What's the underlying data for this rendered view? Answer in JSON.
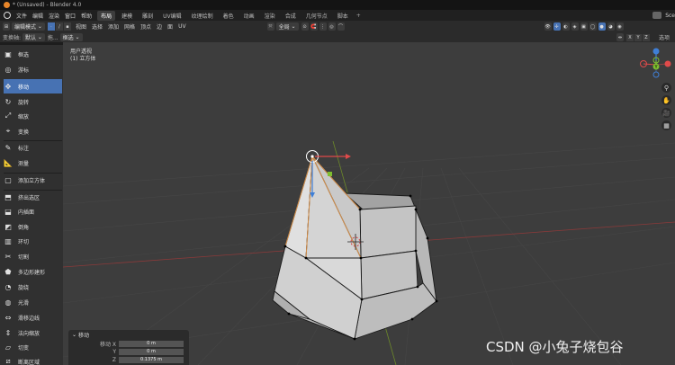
{
  "window": {
    "title": "* (Unsaved) - Blender 4.0"
  },
  "menubar": {
    "menus": [
      "文件",
      "编辑",
      "渲染",
      "窗口",
      "帮助"
    ],
    "workspaces": [
      "布局",
      "建模",
      "雕刻",
      "UV编辑",
      "纹理绘制",
      "着色",
      "动画",
      "渲染",
      "合成",
      "几何节点",
      "脚本"
    ],
    "active_workspace": 0,
    "scene": "Sce"
  },
  "header": {
    "mode": "编辑模式",
    "menus": [
      "视图",
      "选择",
      "添加",
      "网格",
      "顶点",
      "边",
      "面",
      "UV"
    ],
    "orientation": "全局"
  },
  "toolsettings": {
    "transform_label": "变换轴:",
    "pivot": "默认",
    "drag": "拖...",
    "drag_mode": "框选",
    "axes": [
      "X",
      "Y",
      "Z"
    ],
    "options": "选项"
  },
  "toolbar": {
    "tools": [
      {
        "label": "框选",
        "icon": "▣"
      },
      {
        "label": "游标",
        "icon": "◎"
      },
      {
        "label": "移动",
        "icon": "✥"
      },
      {
        "label": "旋转",
        "icon": "↻"
      },
      {
        "label": "缩放",
        "icon": "⤢"
      },
      {
        "label": "变换",
        "icon": "⌖"
      },
      {
        "label": "标注",
        "icon": "✎"
      },
      {
        "label": "测量",
        "icon": "📐"
      },
      {
        "label": "添加立方体",
        "icon": "▢"
      },
      {
        "label": "挤出选区",
        "icon": "⬒"
      },
      {
        "label": "内插面",
        "icon": "⬓"
      },
      {
        "label": "倒角",
        "icon": "◩"
      },
      {
        "label": "环切",
        "icon": "▥"
      },
      {
        "label": "切割",
        "icon": "✂"
      },
      {
        "label": "多边形建形",
        "icon": "⬟"
      },
      {
        "label": "旋绕",
        "icon": "◔"
      },
      {
        "label": "光滑",
        "icon": "◍"
      },
      {
        "label": "滑移边线",
        "icon": "⇔"
      },
      {
        "label": "法向缩放",
        "icon": "⇕"
      },
      {
        "label": "切变",
        "icon": "▱"
      },
      {
        "label": "断离区域",
        "icon": "⧄"
      }
    ],
    "active_tool": 2
  },
  "viewport": {
    "view_label": "用户透视",
    "object_label": "(1) 立方体"
  },
  "gizmo": {
    "axis_labels": [
      "X",
      "Y",
      "Z"
    ],
    "colors": {
      "x": "#e04a4a",
      "y": "#7fbf2f",
      "z": "#3f7fd6"
    }
  },
  "nav_buttons": [
    {
      "name": "zoom",
      "icon": "⚲"
    },
    {
      "name": "pan",
      "icon": "✋"
    },
    {
      "name": "camera",
      "icon": "🎥"
    },
    {
      "name": "grid",
      "icon": "▦"
    }
  ],
  "operator_panel": {
    "title": "移动",
    "rows": [
      {
        "label": "移动 X",
        "value": "0 m"
      },
      {
        "label": "Y",
        "value": "0 m"
      },
      {
        "label": "Z",
        "value": "0.1375 m"
      }
    ]
  },
  "watermark": "CSDN @小兔子烧包谷",
  "colors": {
    "accent": "#4772b3",
    "viewport_bg": "#3d3d3d",
    "mesh_face": "#c8c8c8",
    "mesh_edge": "#1a1a1a"
  }
}
